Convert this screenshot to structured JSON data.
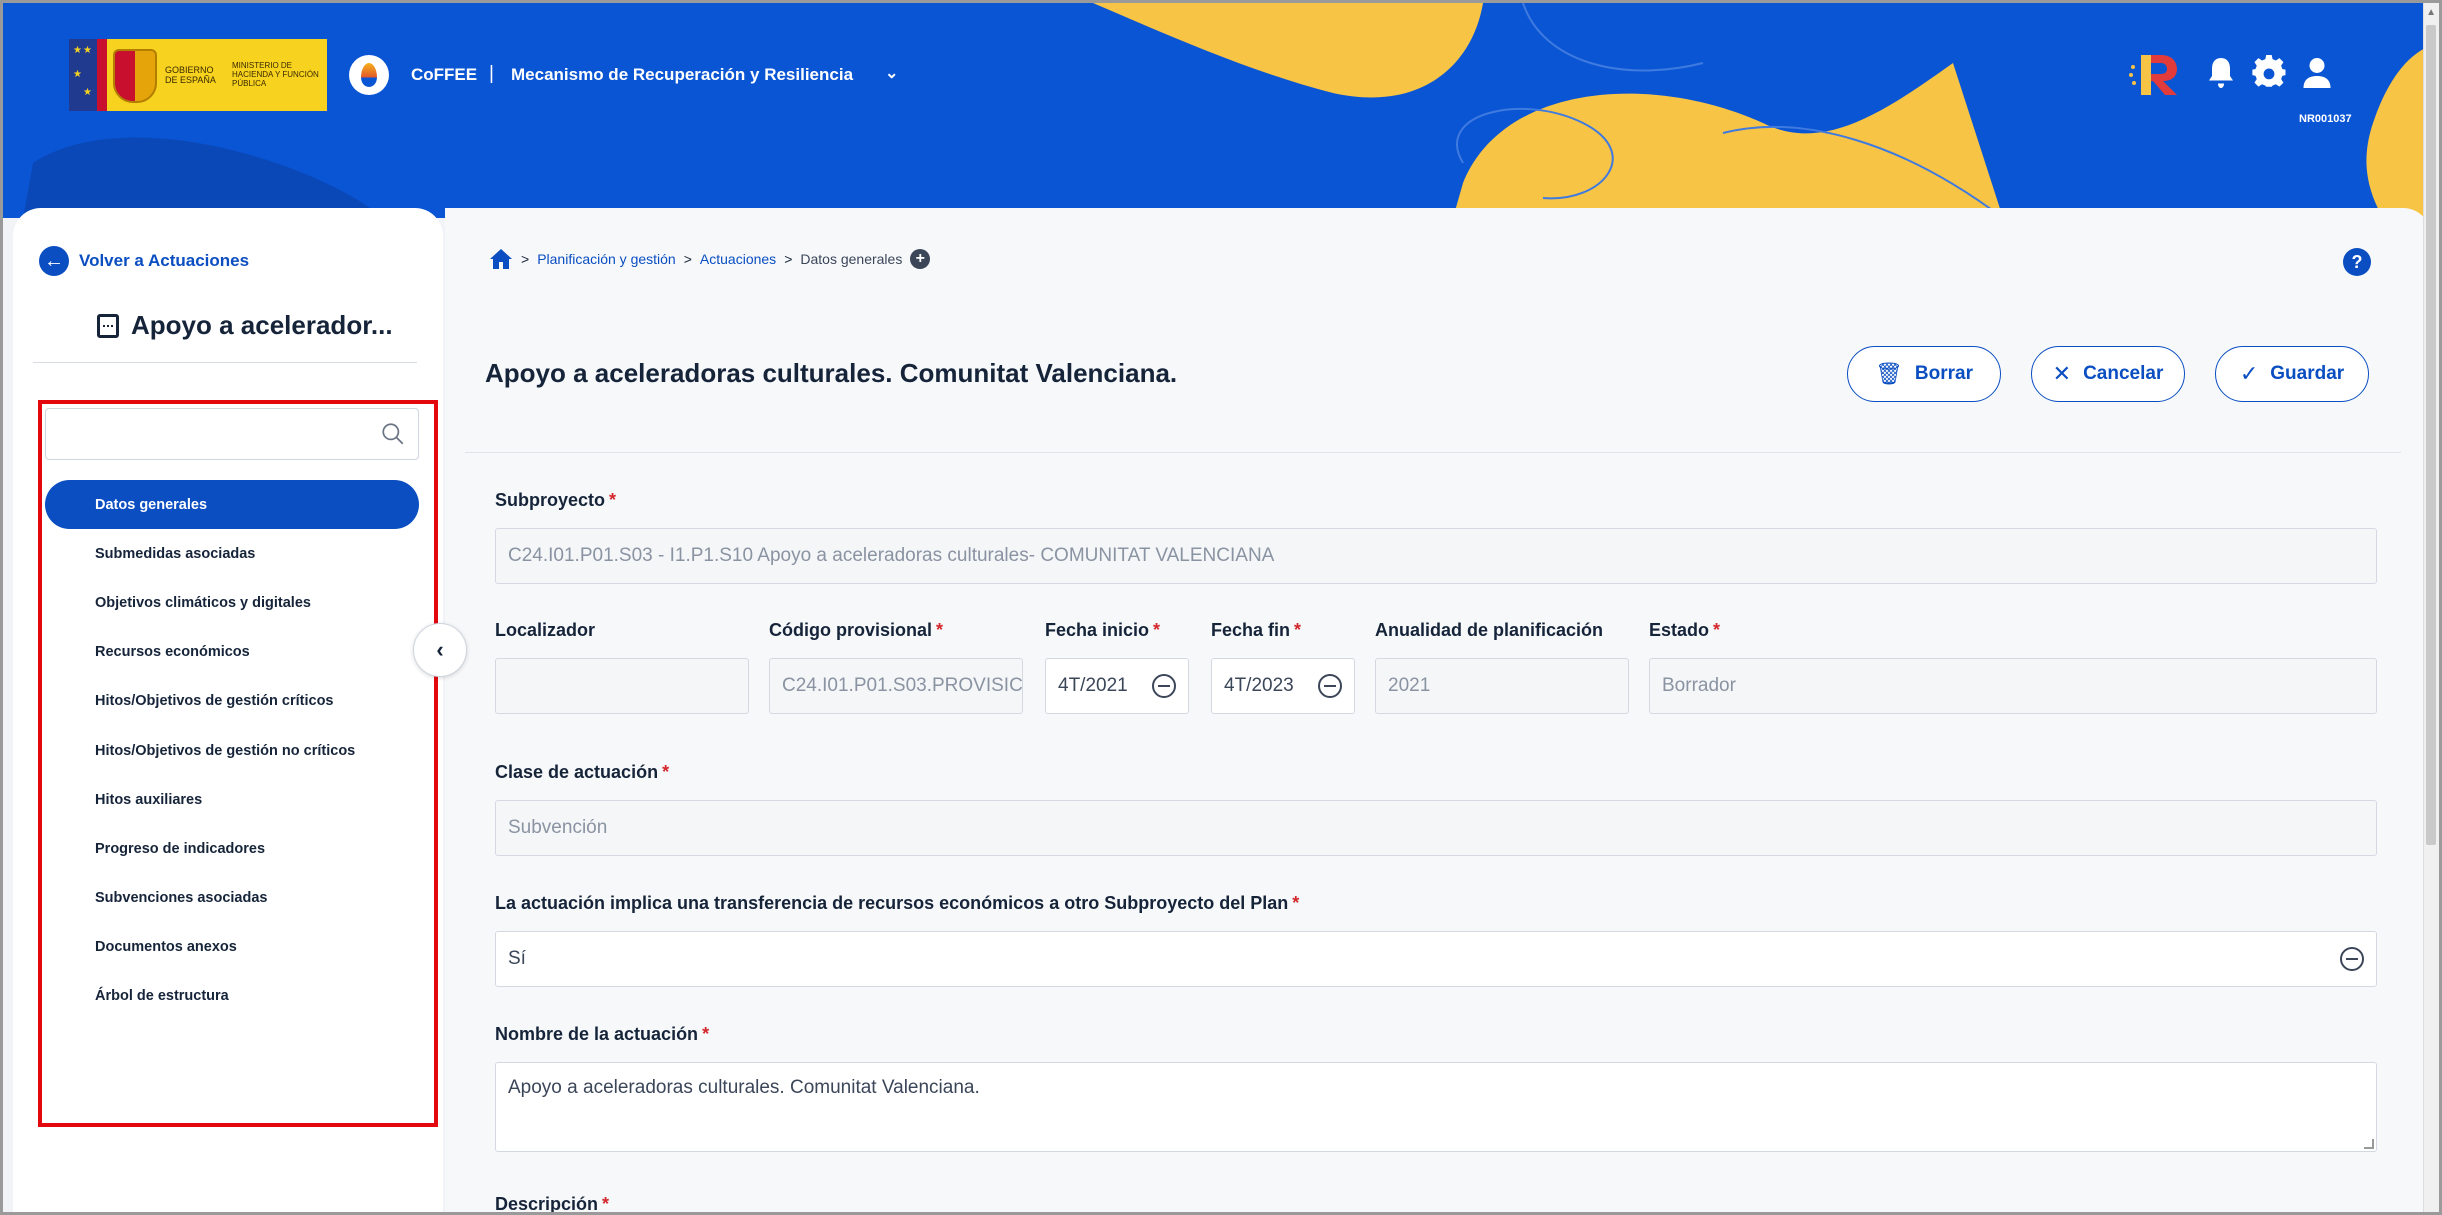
{
  "header": {
    "logo_text_1": "GOBIERNO DE ESPAÑA",
    "logo_text_2": "MINISTERIO DE HACIENDA Y FUNCIÓN PÚBLICA",
    "app_name": "CoFFEE",
    "separator": "|",
    "module": "Mecanismo de Recuperación y Resiliencia",
    "user_code": "NR001037",
    "colors": {
      "brand_blue": "#0a55d4",
      "accent_yellow": "#f7c445"
    }
  },
  "sidebar": {
    "back_label": "Volver a Actuaciones",
    "title": "Apoyo a acelerador...",
    "search": {
      "placeholder": "",
      "value": ""
    },
    "items": [
      {
        "label": "Datos generales",
        "active": true
      },
      {
        "label": "Submedidas asociadas"
      },
      {
        "label": "Objetivos climáticos y digitales"
      },
      {
        "label": "Recursos económicos"
      },
      {
        "label": "Hitos/Objetivos de gestión críticos"
      },
      {
        "label": "Hitos/Objetivos de gestión no críticos"
      },
      {
        "label": "Hitos auxiliares"
      },
      {
        "label": "Progreso de indicadores"
      },
      {
        "label": "Subvenciones asociadas"
      },
      {
        "label": "Documentos anexos"
      },
      {
        "label": "Árbol de estructura"
      }
    ]
  },
  "breadcrumb": {
    "items": [
      "Planificación y gestión",
      "Actuaciones",
      "Datos generales"
    ],
    "separator": ">"
  },
  "main": {
    "title": "Apoyo a aceleradoras culturales. Comunitat Valenciana.",
    "buttons": {
      "delete": "Borrar",
      "cancel": "Cancelar",
      "save": "Guardar"
    },
    "required_mark": "*",
    "fields": {
      "subproyecto": {
        "label": "Subproyecto",
        "value": "C24.I01.P01.S03 - I1.P1.S10 Apoyo a aceleradoras culturales- COMUNITAT VALENCIANA"
      },
      "localizador": {
        "label": "Localizador",
        "value": ""
      },
      "codigo": {
        "label": "Código provisional",
        "value": "C24.I01.P01.S03.PROVISIC"
      },
      "fecha_inicio": {
        "label": "Fecha inicio",
        "value": "4T/2021"
      },
      "fecha_fin": {
        "label": "Fecha fin",
        "value": "4T/2023"
      },
      "anualidad": {
        "label": "Anualidad de planificación",
        "value": "2021"
      },
      "estado": {
        "label": "Estado",
        "value": "Borrador"
      },
      "clase": {
        "label": "Clase de actuación",
        "value": "Subvención"
      },
      "transferencia": {
        "label": "La actuación implica una transferencia de recursos económicos a otro Subproyecto del Plan",
        "value": "Sí"
      },
      "nombre": {
        "label": "Nombre de la actuación",
        "value": "Apoyo a aceleradoras culturales. Comunitat Valenciana."
      },
      "descripcion": {
        "label": "Descripción"
      }
    }
  }
}
